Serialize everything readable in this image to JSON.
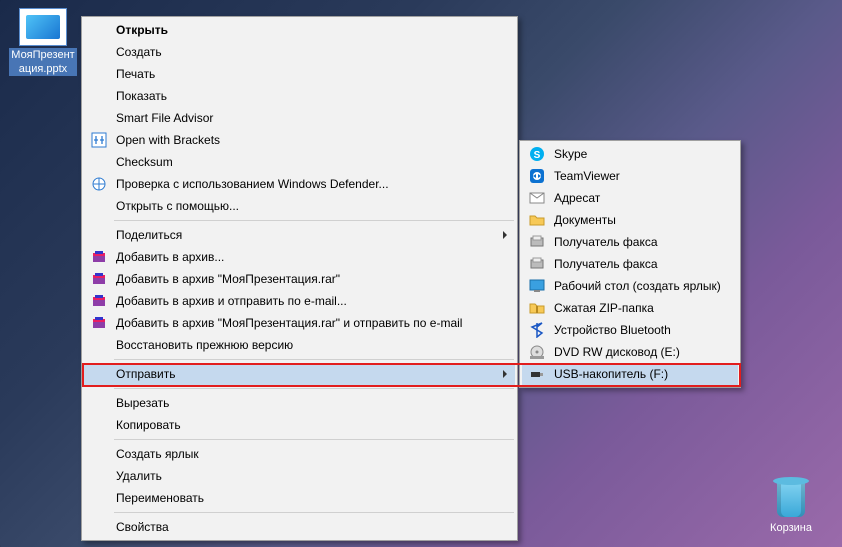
{
  "desktop": {
    "file_icon": {
      "label": "МояПрезент\nация.pptx"
    },
    "recycle_bin": {
      "label": "Корзина"
    }
  },
  "context_menu": {
    "open": "Открыть",
    "new": "Создать",
    "print": "Печать",
    "show": "Показать",
    "smart_file_advisor": "Smart File Advisor",
    "open_with_brackets": "Open with Brackets",
    "checksum": "Checksum",
    "defender": "Проверка с использованием Windows Defender...",
    "open_with": "Открыть с помощью...",
    "share": "Поделиться",
    "add_archive": "Добавить в архив...",
    "add_archive_rar": "Добавить в архив \"МояПрезентация.rar\"",
    "add_archive_email": "Добавить в архив и отправить по e-mail...",
    "add_archive_rar_email": "Добавить в архив \"МояПрезентация.rar\" и отправить по e-mail",
    "restore_prev": "Восстановить прежнюю версию",
    "send_to": "Отправить",
    "cut": "Вырезать",
    "copy": "Копировать",
    "create_shortcut": "Создать ярлык",
    "delete": "Удалить",
    "rename": "Переименовать",
    "properties": "Свойства"
  },
  "submenu": {
    "skype": "Skype",
    "teamviewer": "TeamViewer",
    "recipient": "Адресат",
    "documents": "Документы",
    "fax1": "Получатель факса",
    "fax2": "Получатель факса",
    "desktop_shortcut": "Рабочий стол (создать ярлык)",
    "zip": "Сжатая ZIP-папка",
    "bluetooth": "Устройство Bluetooth",
    "dvd": "DVD RW дисковод (E:)",
    "usb": "USB-накопитель (F:)"
  }
}
